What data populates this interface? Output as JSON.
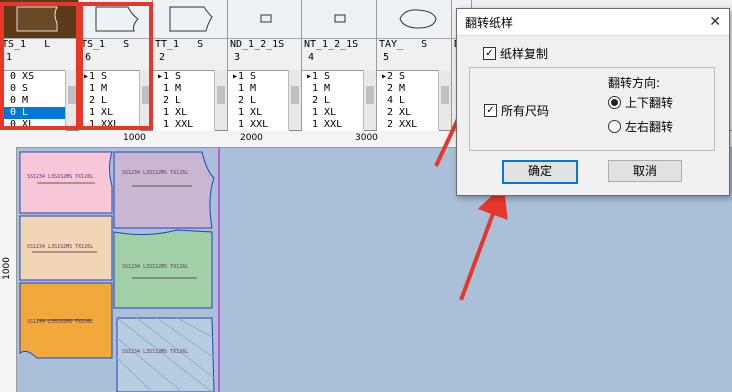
{
  "pieces": [
    {
      "name": "TS_1   L",
      "qty": "1",
      "sizes": [
        "0 XS",
        "0 S",
        "0 M",
        "0 L",
        "0 XL"
      ],
      "selected": 3
    },
    {
      "name": "TS_1   S",
      "qty": "6",
      "sizes": [
        "1 S",
        "1 M",
        "2 L",
        "1 XL",
        "1 XXL"
      ],
      "selected": -1
    },
    {
      "name": "TT_1   S",
      "qty": "2",
      "sizes": [
        "1 S",
        "1 M",
        "2 L",
        "1 XL",
        "1 XXL"
      ],
      "selected": -1
    },
    {
      "name": "ND_1_2_1S",
      "qty": "3",
      "sizes": [
        "1 S",
        "1 M",
        "2 L",
        "1 XL",
        "1 XXL"
      ],
      "selected": -1
    },
    {
      "name": "NT_1_2_1S",
      "qty": "4",
      "sizes": [
        "1 S",
        "1 M",
        "2 L",
        "1 XL",
        "1 XXL"
      ],
      "selected": -1
    },
    {
      "name": "TAY_   S",
      "qty": "5",
      "sizes": [
        "2 S",
        "2 M",
        "4 L",
        "2 XL",
        "2 XXL"
      ],
      "selected": -1
    },
    {
      "name": "D",
      "qty": "",
      "sizes": [],
      "selected": -1
    }
  ],
  "ruler": {
    "h": [
      "1000",
      "2000",
      "3000"
    ],
    "v": [
      "1000"
    ]
  },
  "layout_label": "SS1234 L3S1S2MS TX126L",
  "dialog": {
    "title": "翻转纸样",
    "copy_label": "纸样复制",
    "copy_checked": true,
    "all_sizes_label": "所有尺码",
    "all_sizes_checked": true,
    "direction_label": "翻转方向:",
    "opt_updown": "上下翻转",
    "opt_leftright": "左右翻转",
    "selected": "updown",
    "ok": "确定",
    "cancel": "取消"
  },
  "colors": {
    "arrow": "#e8362b",
    "accent": "#0078d7"
  }
}
